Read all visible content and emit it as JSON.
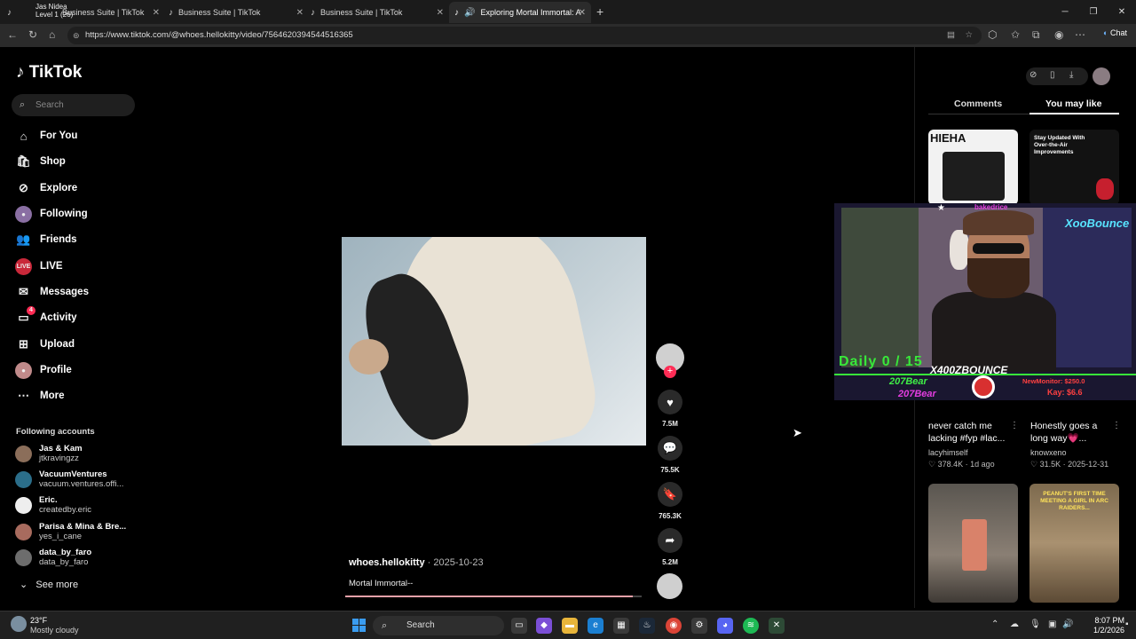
{
  "browser": {
    "tabs": [
      {
        "title": "Business Suite | TikTok"
      },
      {
        "title": "Business Suite | TikTok"
      },
      {
        "title": "Business Suite | TikTok"
      },
      {
        "title": "Exploring Mortal Immortal: A"
      }
    ],
    "first_tab_overlay": {
      "line1": "Jas Nidea",
      "line2": "Level 1  (26)"
    },
    "url": "https://www.tiktok.com/@whoes.hellokitty/video/7564620394544516365",
    "chat_label": "Chat"
  },
  "tiktok": {
    "logo": "TikTok",
    "search_placeholder": "Search",
    "nav": [
      {
        "label": "For You",
        "icon": "home-icon"
      },
      {
        "label": "Shop",
        "icon": "shop-bag-icon"
      },
      {
        "label": "Explore",
        "icon": "compass-icon"
      },
      {
        "label": "Following",
        "icon": "following-avatar-icon"
      },
      {
        "label": "Friends",
        "icon": "friends-icon"
      },
      {
        "label": "LIVE",
        "icon": "live-icon"
      },
      {
        "label": "Messages",
        "icon": "messages-icon"
      },
      {
        "label": "Activity",
        "icon": "activity-icon",
        "badge": "4"
      },
      {
        "label": "Upload",
        "icon": "upload-icon"
      },
      {
        "label": "Profile",
        "icon": "profile-avatar-icon"
      },
      {
        "label": "More",
        "icon": "more-dots-icon"
      }
    ],
    "following_header": "Following accounts",
    "accounts": [
      {
        "name": "Jas & Kam",
        "handle": "jtkravingzz"
      },
      {
        "name": "VacuumVentures",
        "handle": "vacuum.ventures.offi..."
      },
      {
        "name": "Eric.",
        "handle": "createdby.eric"
      },
      {
        "name": "Parisa & Mina & Bre...",
        "handle": "yes_i_cane"
      },
      {
        "name": "data_by_faro",
        "handle": "data_by_faro"
      }
    ],
    "see_more": "See more"
  },
  "video": {
    "author": "whoes.hellokitty",
    "date": " · 2025-10-23",
    "caption": "Mortal Immortal--",
    "likes": "7.5M",
    "comments": "75.5K",
    "saves": "765.3K",
    "shares": "5.2M",
    "progress": 0.97
  },
  "right_panel": {
    "tabs": [
      "Comments",
      "You may like"
    ],
    "active_tab": "You may like",
    "ad1_brand": "HIEHA",
    "ad2_text": "Stay Updated With Over-the-Air Improvements",
    "videos": [
      {
        "title": "never catch me lacking #fyp #lac...",
        "user": "lacyhimself",
        "meta": "♡ 378.4K · 1d ago"
      },
      {
        "title": "Honestly goes a long way💗...",
        "user": "knowxeno",
        "meta": "♡ 31.5K · 2025-12-31"
      }
    ],
    "thumb6_text": "PEANUT'S FIRST TIME MEETING A GIRL IN ARC RAIDERS..."
  },
  "stream_overlay": {
    "top_name": "bakedrice",
    "neon_sign": "XooBounce",
    "daily": "Daily 0 / 15",
    "streamer": "X400ZBOUNCE",
    "sub1": "207Bear",
    "sub2": "207Bear",
    "monitor": "NewMonitor: $250.0",
    "kay": "Kay: $6.6"
  },
  "taskbar": {
    "temp": "23°F",
    "condition": "Mostly cloudy",
    "search": "Search",
    "time": "8:07 PM",
    "date": "1/2/2026"
  },
  "colors": {
    "accent": "#fe2c55",
    "progress": "#e8a0a8",
    "overlay_green": "#38e83a",
    "overlay_pink": "#e33de0"
  }
}
